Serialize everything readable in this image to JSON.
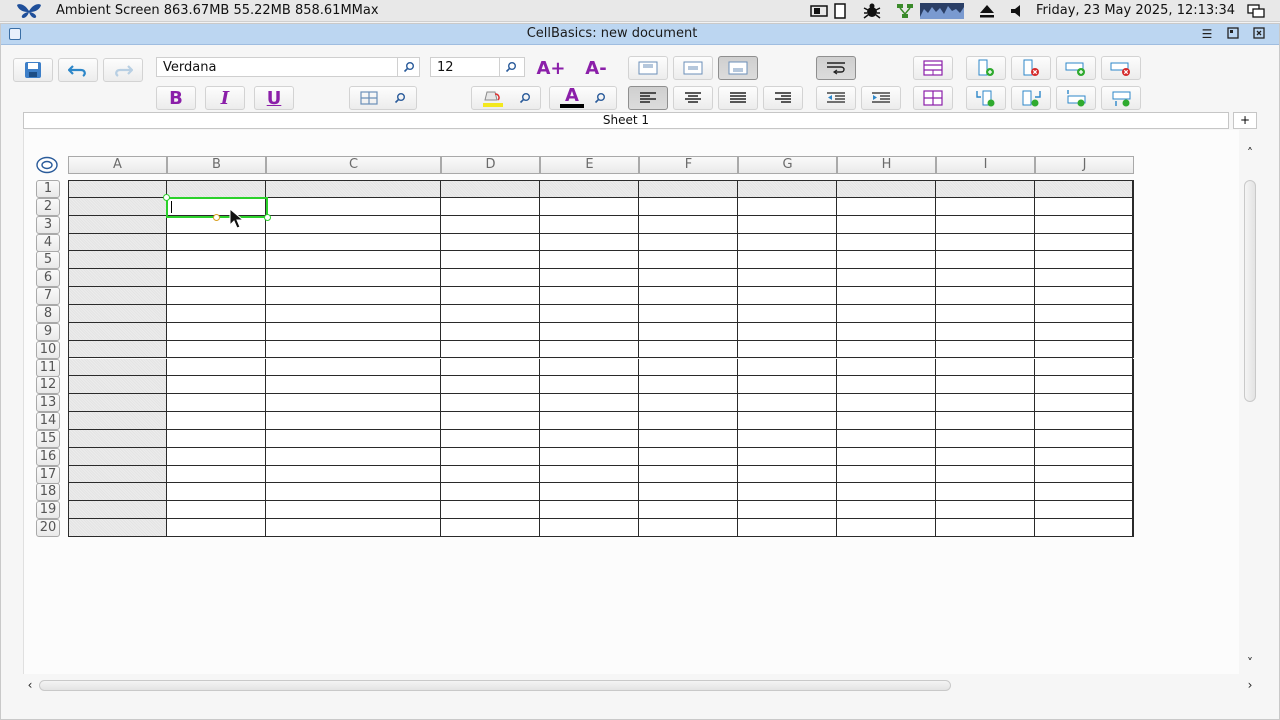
{
  "sysbar": {
    "app_title": "Ambient Screen 863.67MB 55.22MB 858.61MMax",
    "clock": "Friday, 23 May 2025, 12:13:34"
  },
  "window": {
    "title": "CellBasics: new document"
  },
  "toolbar": {
    "font_name": "Verdana",
    "font_size": "12",
    "grow_font": "A+",
    "shrink_font": "A-",
    "bold": "B",
    "italic": "I",
    "underline": "U",
    "text_color_letter": "A",
    "accent_purple": "#8b1fa9",
    "highlight_yellow": "#f3e81e"
  },
  "sheet": {
    "tab_label": "Sheet 1",
    "add_tab": "+",
    "columns": [
      "A",
      "B",
      "C",
      "D",
      "E",
      "F",
      "G",
      "H",
      "I",
      "J"
    ],
    "rows": [
      "1",
      "2",
      "3",
      "4",
      "5",
      "6",
      "7",
      "8",
      "9",
      "10",
      "11",
      "12",
      "13",
      "14",
      "15",
      "16",
      "17",
      "18",
      "19",
      "20"
    ],
    "selected_cell": "B2",
    "selection_color": "#2bd12b"
  }
}
